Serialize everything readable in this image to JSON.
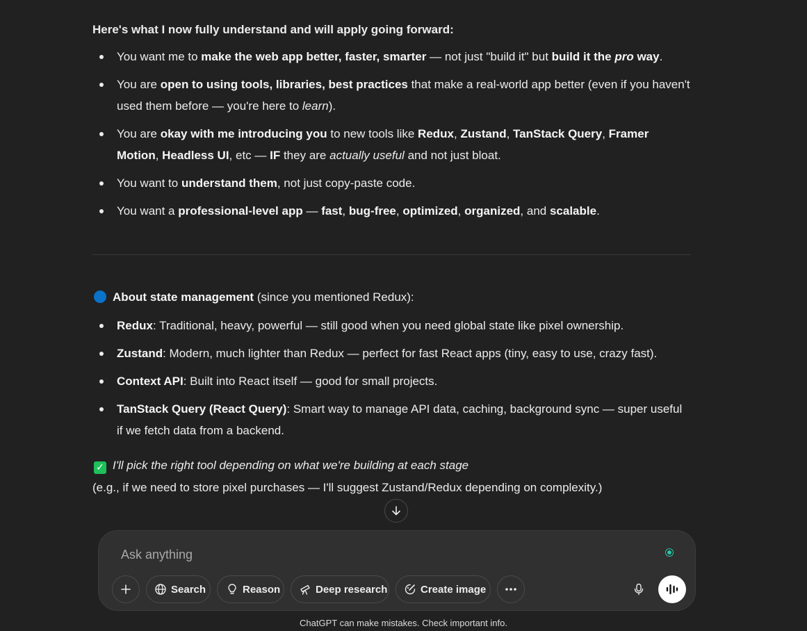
{
  "message": {
    "heading": "Here's what I now fully understand and will apply going forward:",
    "bullets1": [
      {
        "a": "You want me to ",
        "b": "make the web app better, faster, smarter",
        "c": " — not just \"build it\" but ",
        "d": "build it the ",
        "e": "pro",
        "f": " way",
        "g": "."
      },
      {
        "a": "You are ",
        "b": "open to using tools, libraries, best practices",
        "c": " that make a real-world app better (even if you haven't used them before — you're here to ",
        "d": "learn",
        "e": ")."
      },
      {
        "a": "You are ",
        "b": "okay with me introducing you",
        "c": " to new tools like ",
        "d": "Redux",
        "e": ", ",
        "f": "Zustand",
        "g": ", ",
        "h": "TanStack Query",
        "i": ", ",
        "j": "Framer Motion",
        "k": ", ",
        "l": "Headless UI",
        "m": ", etc — ",
        "n": "IF",
        "o": " they are ",
        "p": "actually useful",
        "q": " and not just bloat."
      },
      {
        "a": "You want to ",
        "b": "understand them",
        "c": ", not just copy-paste code."
      },
      {
        "a": "You want a ",
        "b": "professional-level app",
        "c": " — ",
        "d": "fast",
        "e": ", ",
        "f": "bug-free",
        "g": ", ",
        "h": "optimized",
        "i": ", ",
        "j": "organized",
        "k": ", and ",
        "l": "scalable",
        "m": "."
      }
    ],
    "state_title_bold": "About state management",
    "state_title_rest": " (since you mentioned Redux):",
    "bullets2": [
      {
        "b": "Redux",
        "c": ": Traditional, heavy, powerful — still good when you need global state like pixel ownership."
      },
      {
        "b": "Zustand",
        "c": ": Modern, much lighter than Redux — perfect for fast React apps (tiny, easy to use, crazy fast)."
      },
      {
        "b": "Context API",
        "c": ": Built into React itself — good for small projects."
      },
      {
        "b": "TanStack Query (React Query)",
        "c": ": Smart way to manage API data, caching, background sync — super useful if we fetch data from a backend."
      }
    ],
    "check_text": "I'll pick the right tool depending on what we're building at each stage",
    "eg_text": "(e.g., if we need to store pixel purchases — I'll suggest Zustand/Redux depending on complexity.)"
  },
  "composer": {
    "placeholder": "Ask anything",
    "search_label": "Search",
    "reason_label": "Reason",
    "deep_research_label": "Deep research",
    "create_image_label": "Create image"
  },
  "footer": "ChatGPT can make mistakes. Check important info.",
  "colors": {
    "background": "#212121",
    "composer": "#303030",
    "blue_dot": "#0a72c8",
    "check_green": "#1fbf5c",
    "voice_dot": "#28c4a8"
  },
  "icons": [
    "blue-circle-icon",
    "check-mark-icon",
    "arrow-down-icon",
    "plus-icon",
    "globe-icon",
    "lightbulb-icon",
    "telescope-icon",
    "image-brush-icon",
    "more-dots-icon",
    "microphone-icon",
    "voice-wave-icon"
  ]
}
